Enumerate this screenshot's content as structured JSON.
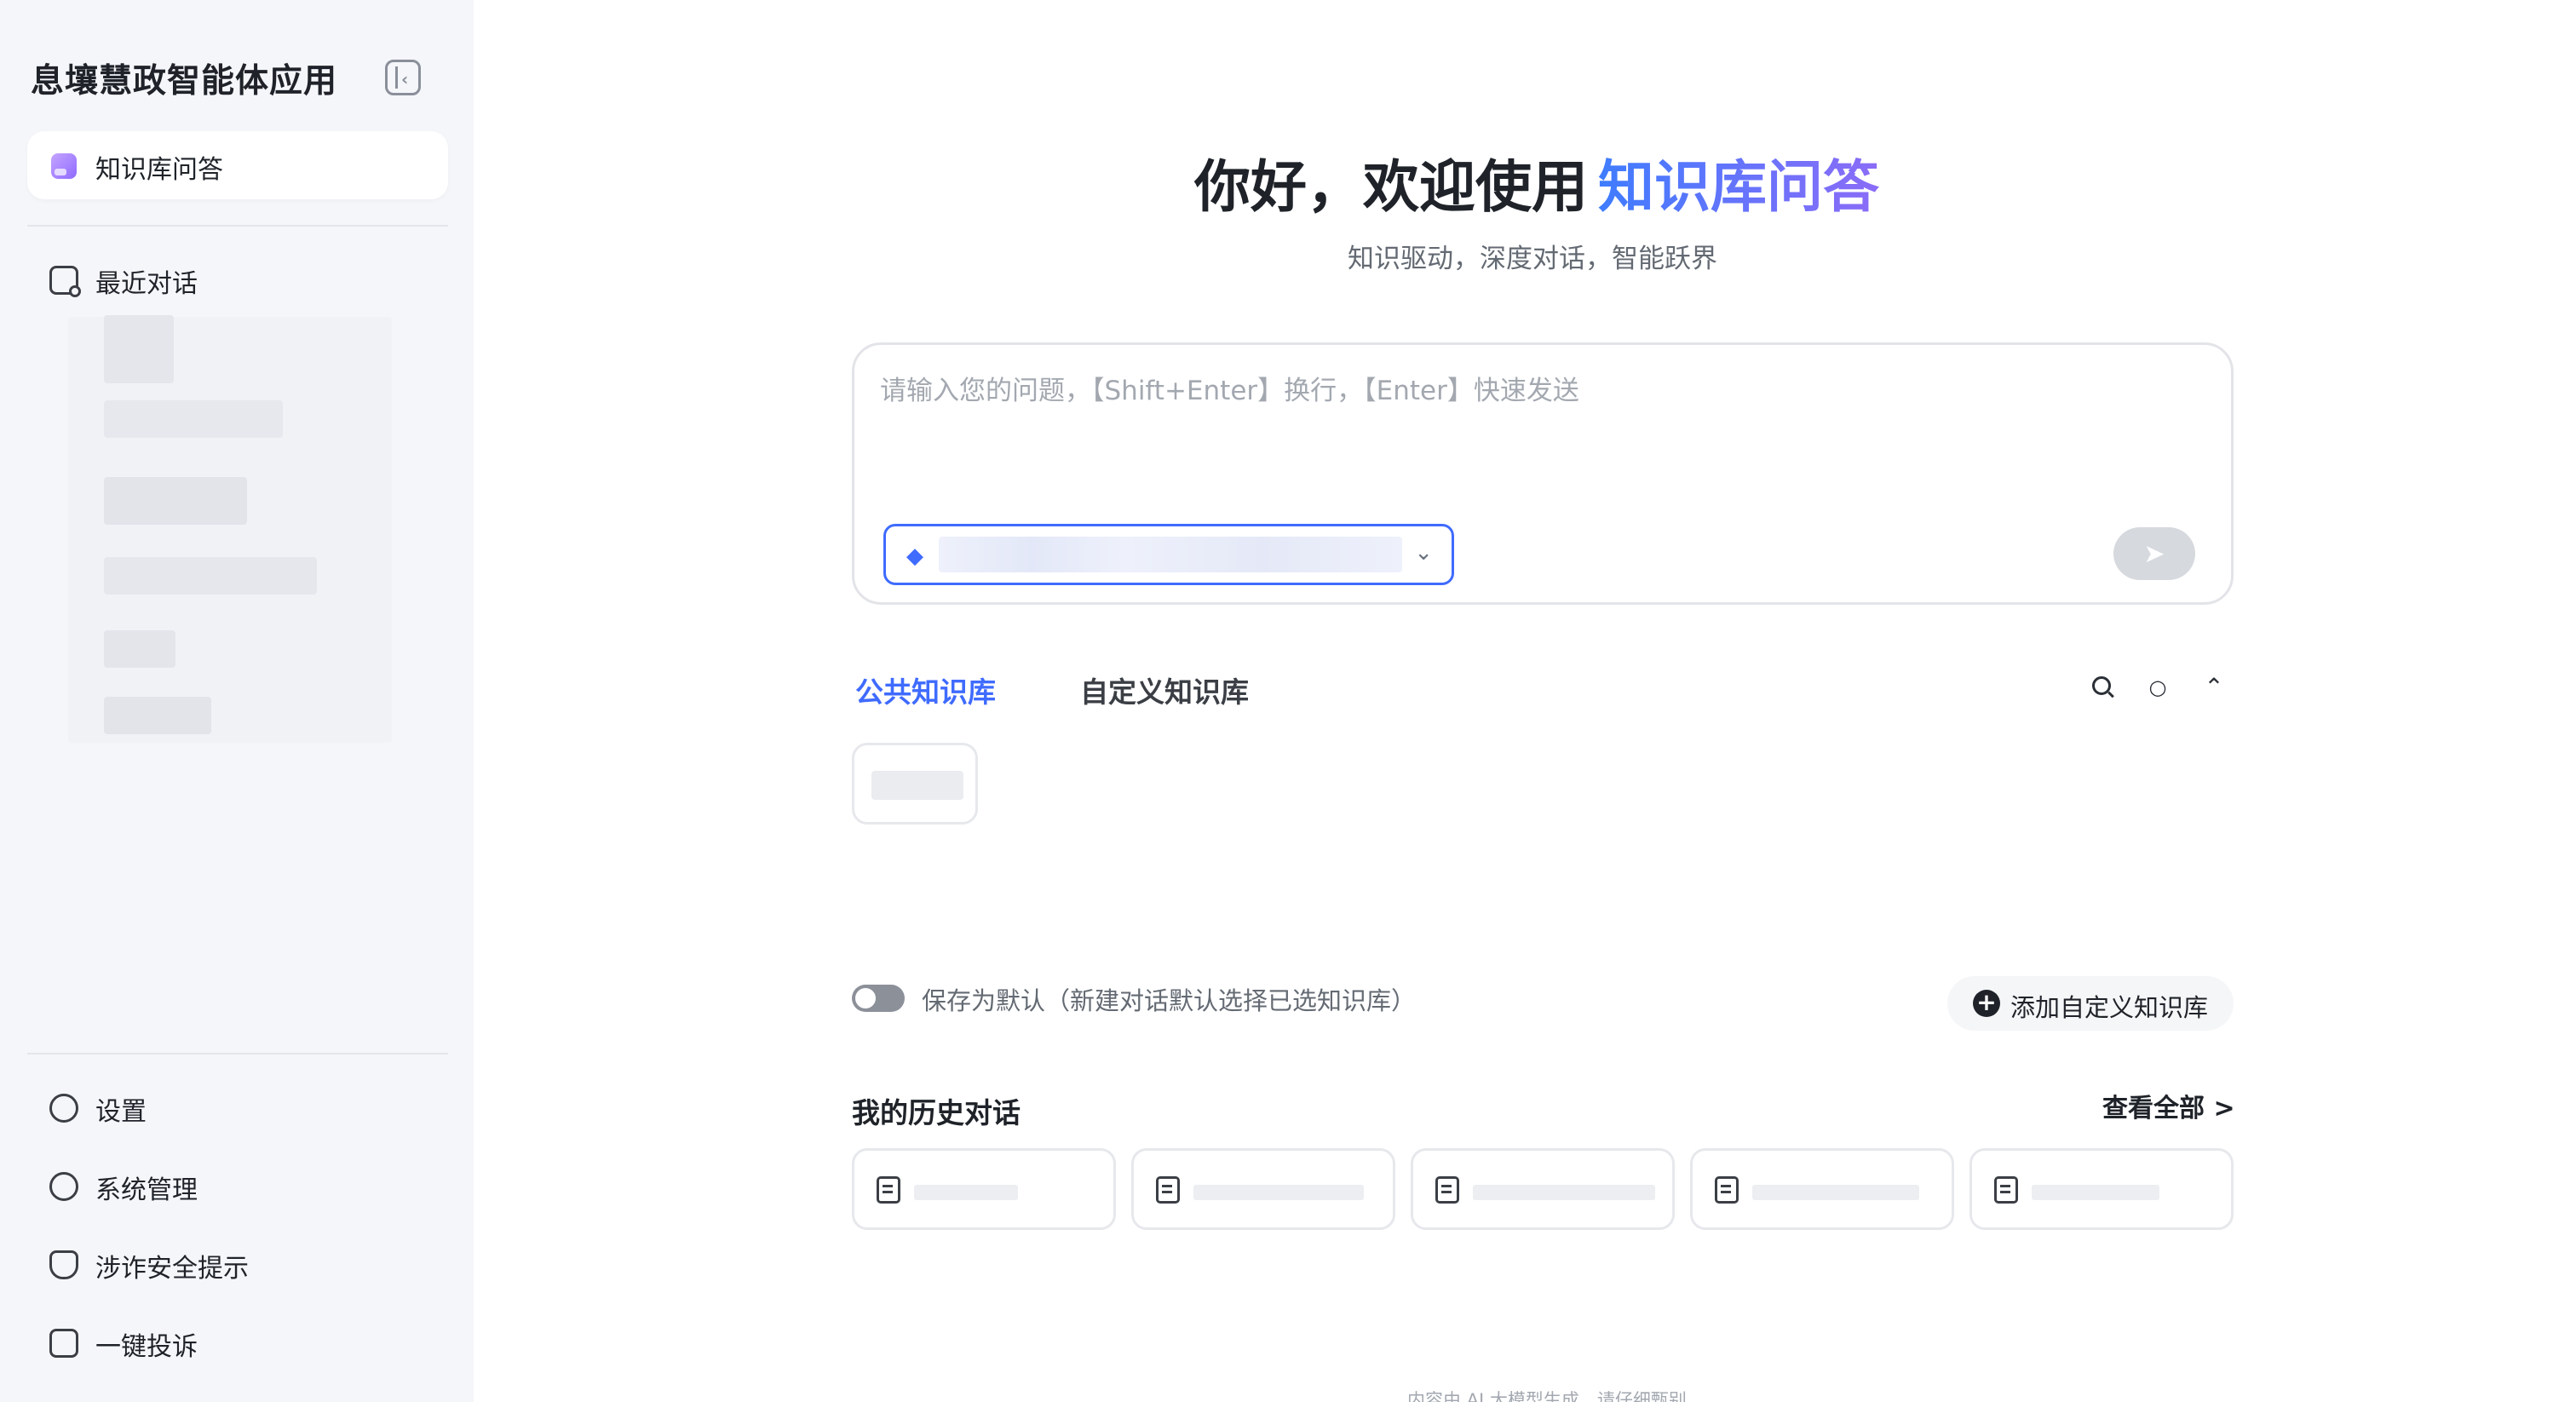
{
  "app": {
    "title": "息壤慧政智能体应用"
  },
  "sidebar": {
    "active_item": "知识库问答",
    "recent_label": "最近对话",
    "bottom_items": [
      {
        "label": "设置",
        "icon": "settings-icon"
      },
      {
        "label": "系统管理",
        "icon": "user-manage-icon"
      },
      {
        "label": "涉诈安全提示",
        "icon": "shield-icon"
      },
      {
        "label": "一键投诉",
        "icon": "complaint-icon"
      }
    ]
  },
  "hero": {
    "greeting": "你好，欢迎使用",
    "highlight": "知识库问答",
    "subtitle": "知识驱动，深度对话，智能跃界"
  },
  "chat": {
    "placeholder": "请输入您的问题，【Shift+Enter】换行，【Enter】快速发送"
  },
  "tabs": {
    "public": "公共知识库",
    "custom": "自定义知识库"
  },
  "toggle": {
    "label": "保存为默认（新建对话默认选择已选知识库）"
  },
  "add_kb": {
    "label": "添加自定义知识库"
  },
  "history": {
    "title": "我的历史对话",
    "view_all": "查看全部 >"
  },
  "footer": {
    "note": "内容由 AI 大模型生成，请仔细甄别"
  },
  "colors": {
    "accent": "#3f6bff",
    "gradient_end": "#8b6cf7",
    "sidebar_bg": "#f5f6fa"
  }
}
